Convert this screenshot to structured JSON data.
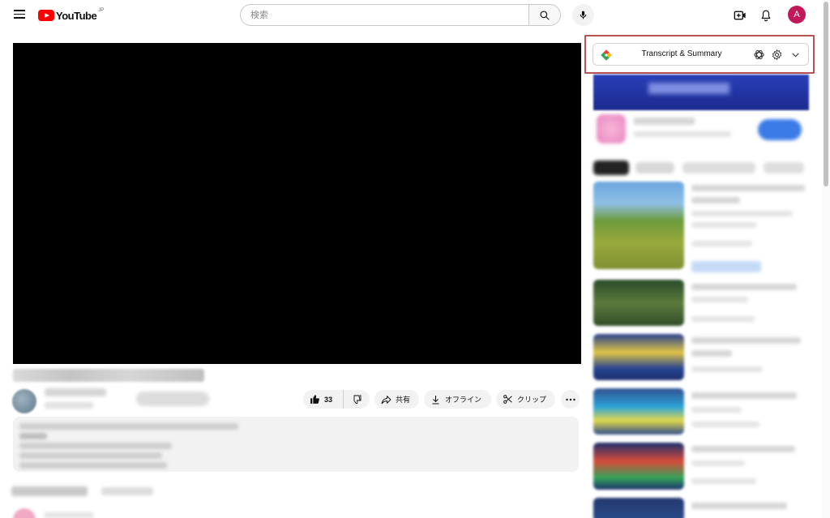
{
  "header": {
    "logo_text": "YouTube",
    "region": "JP",
    "search_placeholder": "検索",
    "avatar_initial": "A"
  },
  "video": {
    "actions": {
      "like_count": "33",
      "share_label": "共有",
      "offline_label": "オフライン",
      "clip_label": "クリップ"
    }
  },
  "extension": {
    "title": "Transcript & Summary"
  },
  "colors": {
    "brand_red": "#ff0000",
    "highlight_border": "#b85450",
    "avatar_bg": "#c2185b"
  },
  "icons": {
    "menu": "hamburger-icon",
    "search": "search-icon",
    "mic": "microphone-icon",
    "create": "create-video-icon",
    "notifications": "bell-icon",
    "like": "thumbs-up-icon",
    "dislike": "thumbs-down-icon",
    "share": "share-arrow-icon",
    "download": "download-icon",
    "clip": "scissors-icon",
    "more": "more-horizontal-icon",
    "ext_logo": "extension-logo-icon",
    "chatgpt": "chatgpt-icon",
    "settings": "gear-icon",
    "expand": "chevron-down-icon"
  }
}
